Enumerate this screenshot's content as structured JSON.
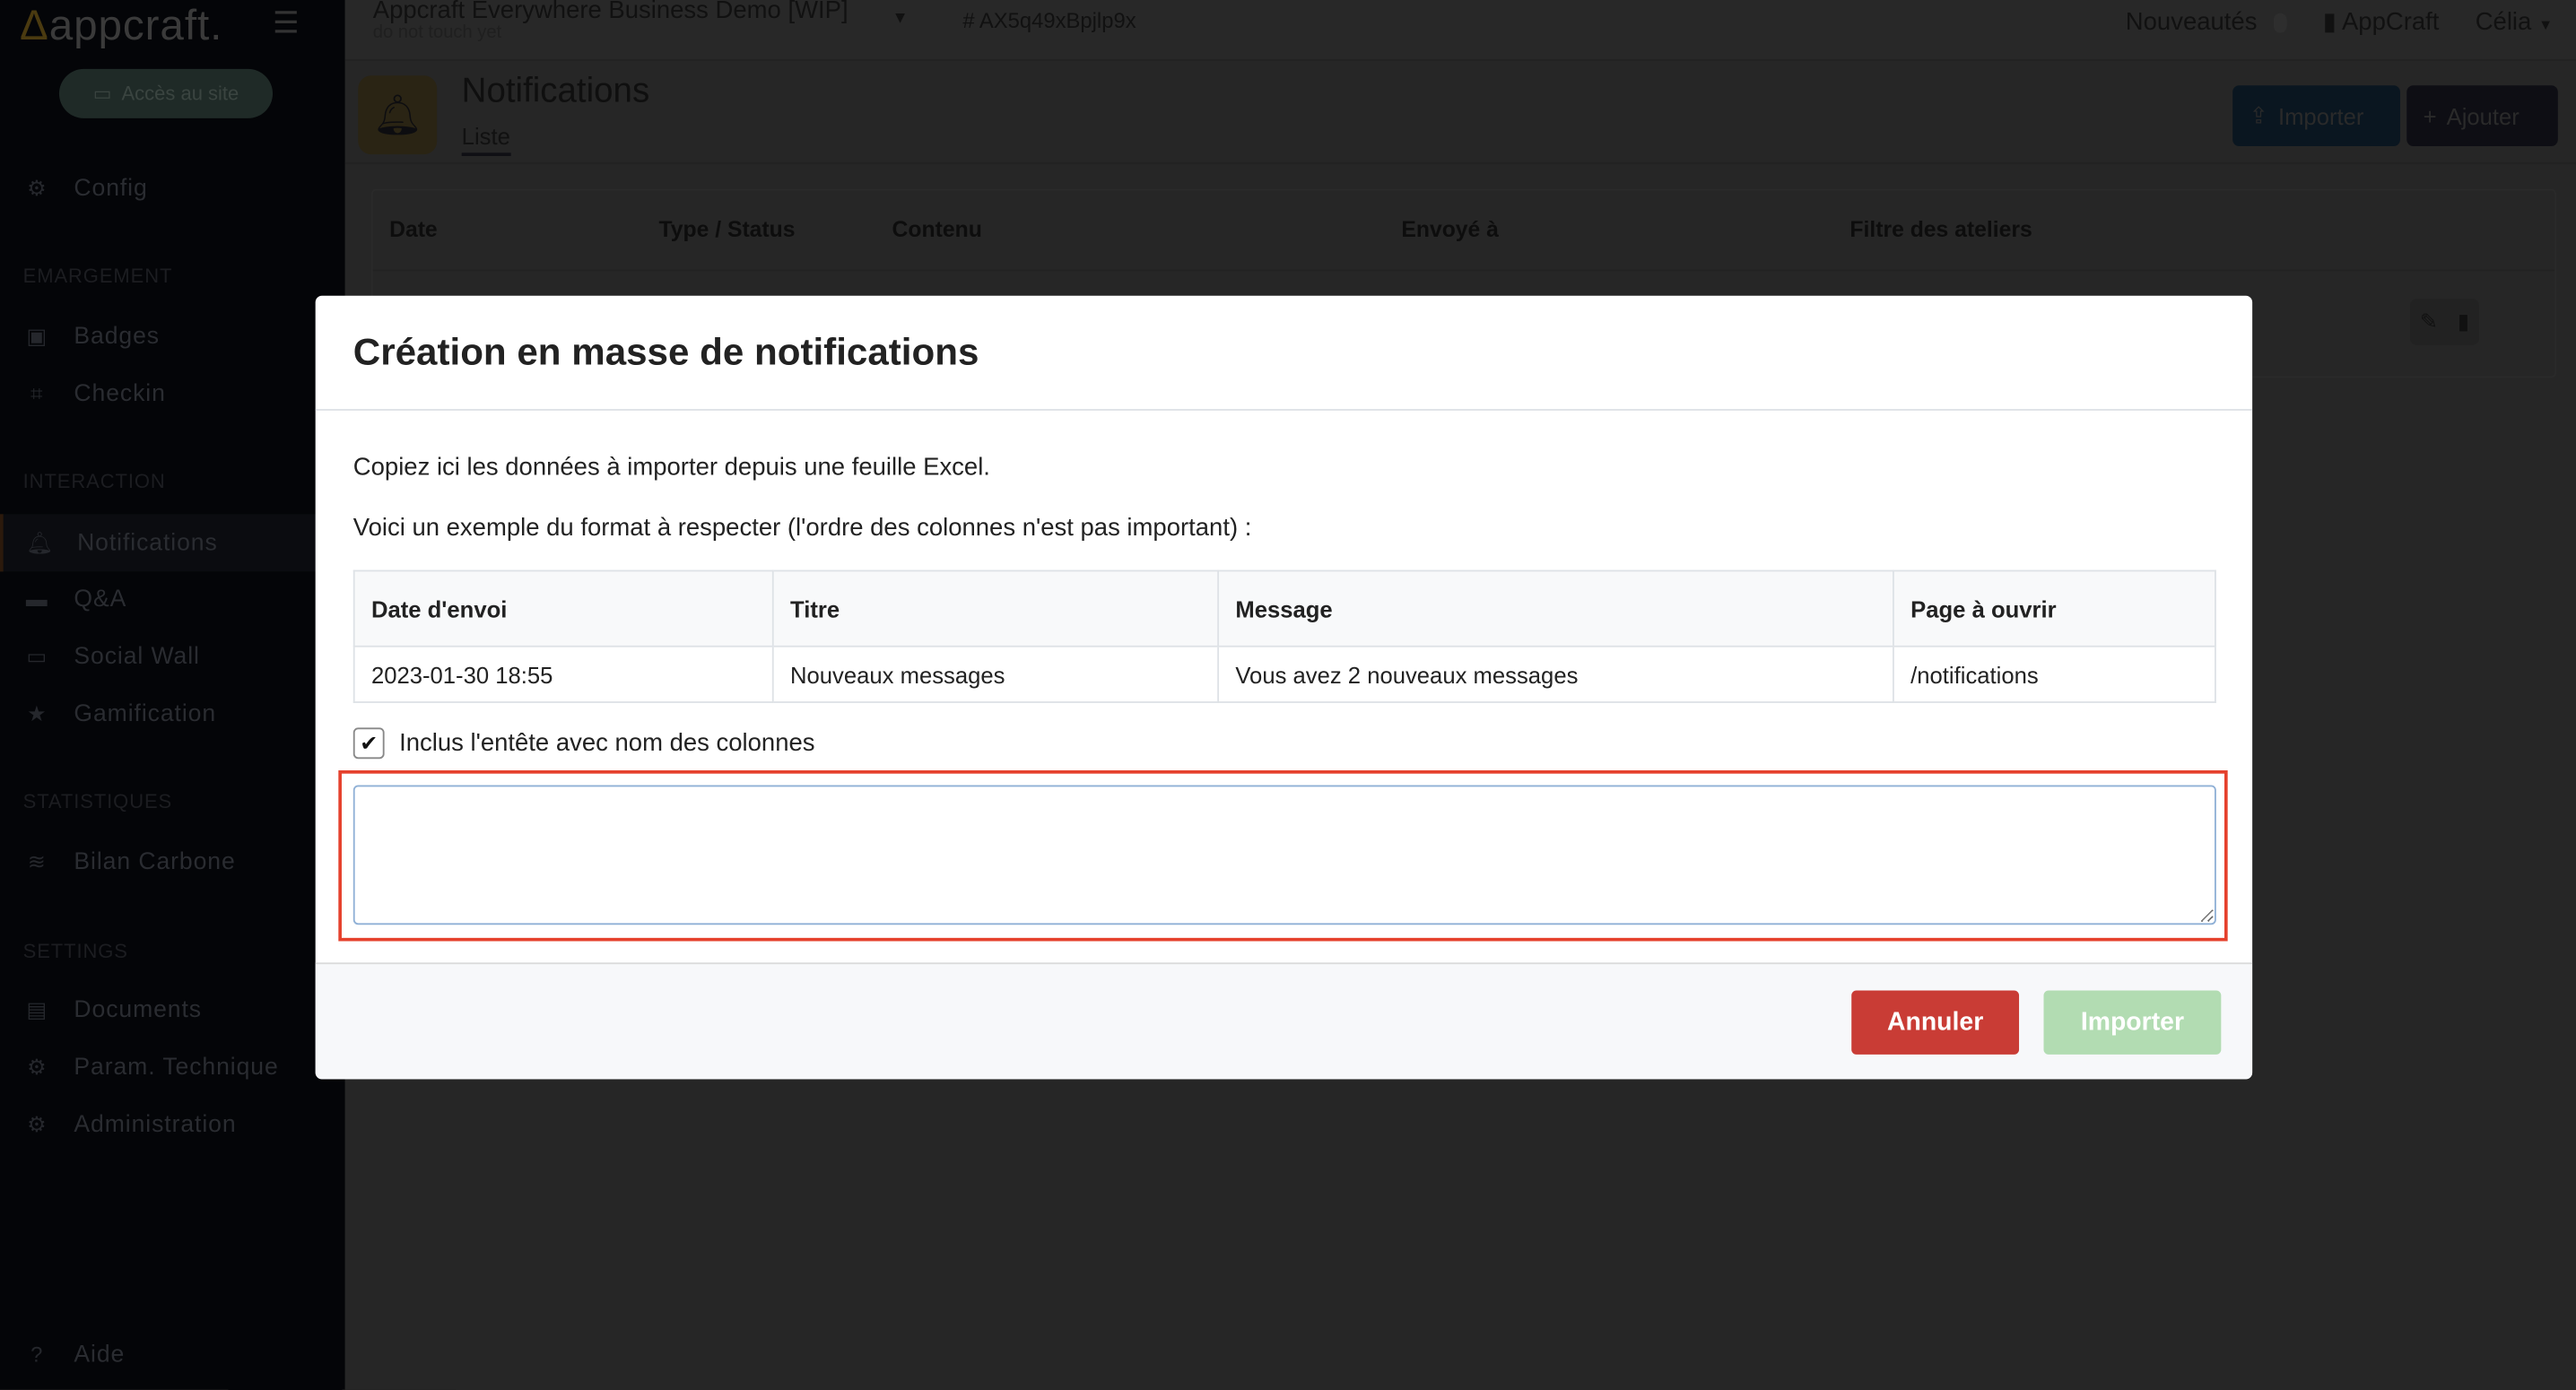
{
  "sidebar": {
    "logo": "appcraft.",
    "site_button": "Accès au site",
    "sections": {
      "emargement": "EMARGEMENT",
      "interaction": "INTERACTION",
      "statistiques": "STATISTIQUES",
      "settings": "SETTINGS"
    },
    "items": {
      "config": "Config",
      "badges": "Badges",
      "checkin": "Checkin",
      "notifications": "Notifications",
      "qa": "Q&A",
      "social_wall": "Social Wall",
      "gamification": "Gamification",
      "bilan_carbone": "Bilan Carbone",
      "documents": "Documents",
      "param_technique": "Param. Technique",
      "administration": "Administration",
      "aide": "Aide"
    }
  },
  "topbar": {
    "app_title": "Appcraft Everywhere Business Demo [WIP]",
    "app_subtitle": "do not touch yet",
    "app_id": "# AX5q49xBpjlp9x",
    "news": "Nouveautés",
    "org": "AppCraft",
    "user": "Célia"
  },
  "page": {
    "title": "Notifications",
    "tab": "Liste",
    "import_button": "Importer",
    "add_button": "Ajouter",
    "columns": [
      "Date",
      "Type / Status",
      "Contenu",
      "Envoyé à",
      "Filtre des ateliers"
    ]
  },
  "modal": {
    "title": "Création en masse de notifications",
    "intro": "Copiez ici les données à importer depuis une feuille Excel.",
    "format_hint": "Voici un exemple du format à respecter (l'ordre des colonnes n'est pas important) :",
    "example": {
      "headers": [
        "Date d'envoi",
        "Titre",
        "Message",
        "Page à ouvrir"
      ],
      "row": [
        "2023-01-30 18:55",
        "Nouveaux messages",
        "Vous avez 2 nouveaux messages",
        "/notifications"
      ]
    },
    "include_header_label": "Inclus l'entête avec nom des colonnes",
    "include_header_checked": true,
    "textarea_value": "",
    "cancel_button": "Annuler",
    "import_button": "Importer"
  },
  "colors": {
    "cancel": "#c93c35",
    "import_disabled": "#b2dcb2",
    "highlight": "#e5412d"
  }
}
